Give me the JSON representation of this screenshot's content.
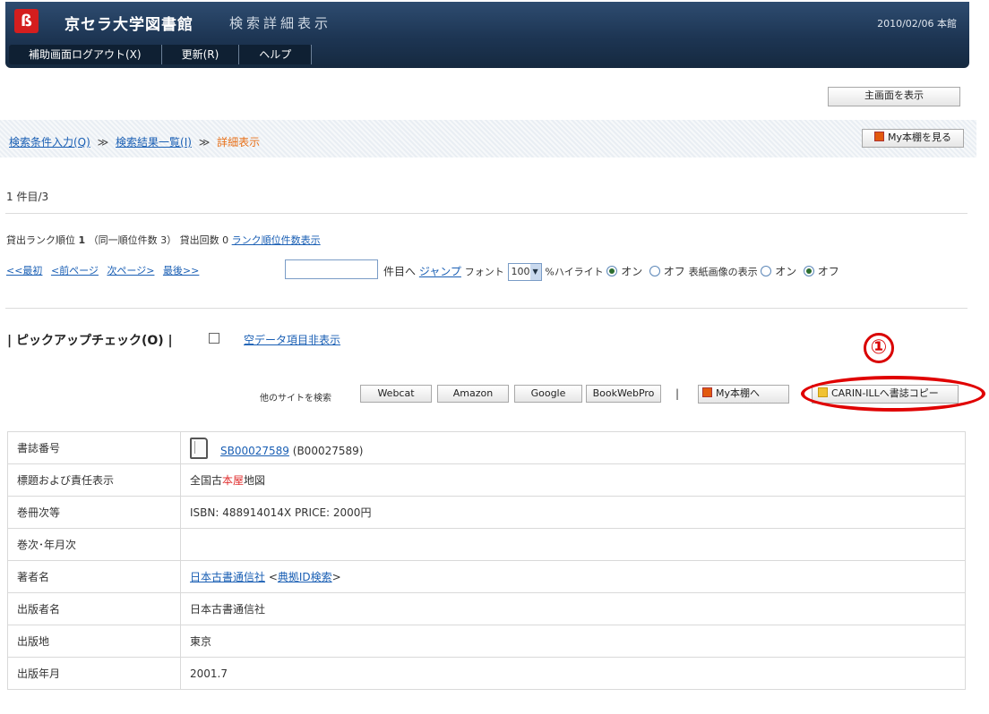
{
  "header": {
    "logo_glyph": "ß",
    "library_name": "京セラ大学図書館",
    "page_subtitle": "検索詳細表示",
    "date_branch": "2010/02/06 本館",
    "menu": [
      "補助画面ログアウト(X)",
      "更新(R)",
      "ヘルプ"
    ]
  },
  "toolbar": {
    "main_screen_button": "主画面を表示"
  },
  "breadcrumb": {
    "items": [
      "検索条件入力(Q)",
      "検索結果一覧(I)"
    ],
    "separator": "≫",
    "current": "詳細表示",
    "my_shelf_button": "My本棚を見る"
  },
  "record": {
    "position": "1 件目/3"
  },
  "rank": {
    "label": "貸出ランク順位",
    "value": "1",
    "same_rank": "（同一順位件数 3）",
    "loans_label": "貸出回数",
    "loans": "0",
    "link": "ランク順位件数表示"
  },
  "navigation": {
    "first": "<<最初",
    "prev": "<前ページ",
    "next": "次ページ>",
    "last": "最後>>",
    "jump_suffix": "件目へ",
    "jump_link": "ジャンプ",
    "font_label": "フォント",
    "font_size": "100",
    "percent_highlight": "%ハイライト",
    "on": "オン",
    "off": "オフ",
    "cover_label": "表紙画像の表示",
    "highlight_selected": "on",
    "cover_selected": "off"
  },
  "pickup": {
    "label": "| ピックアップチェック(O) |",
    "hide_empty_link": "空データ項目非表示"
  },
  "annotation": {
    "number": "①"
  },
  "other_sites": {
    "label": "他のサイトを検索",
    "buttons": [
      "Webcat",
      "Amazon",
      "Google",
      "BookWebPro"
    ],
    "separator": "|",
    "my_shelf_button": "My本棚へ",
    "carin_button": "CARIN-ILLへ書誌コピー"
  },
  "biblio": {
    "rows": [
      {
        "label": "書誌番号",
        "link": "SB00027589",
        "extra": "(B00027589)"
      },
      {
        "label": "標題および責任表示",
        "value_pre": "全国古",
        "value_hl": "本屋",
        "value_post": "地図"
      },
      {
        "label": "巻冊次等",
        "value": "ISBN: 488914014X  PRICE: 2000円"
      },
      {
        "label": "巻次･年月次",
        "value": ""
      },
      {
        "label": "著者名",
        "link": "日本古書通信社",
        "extra_open": " <",
        "extra_link": "典拠ID検索",
        "extra_close": ">"
      },
      {
        "label": "出版者名",
        "value": "日本古書通信社"
      },
      {
        "label": "出版地",
        "value": "東京"
      },
      {
        "label": "出版年月",
        "value": "2001.7"
      }
    ]
  },
  "colors": {
    "header_bg": "#1d3553",
    "link": "#1a5fb4",
    "current_crumb": "#e8711a",
    "annotation_red": "#d90000",
    "highlight": "#e03030"
  }
}
